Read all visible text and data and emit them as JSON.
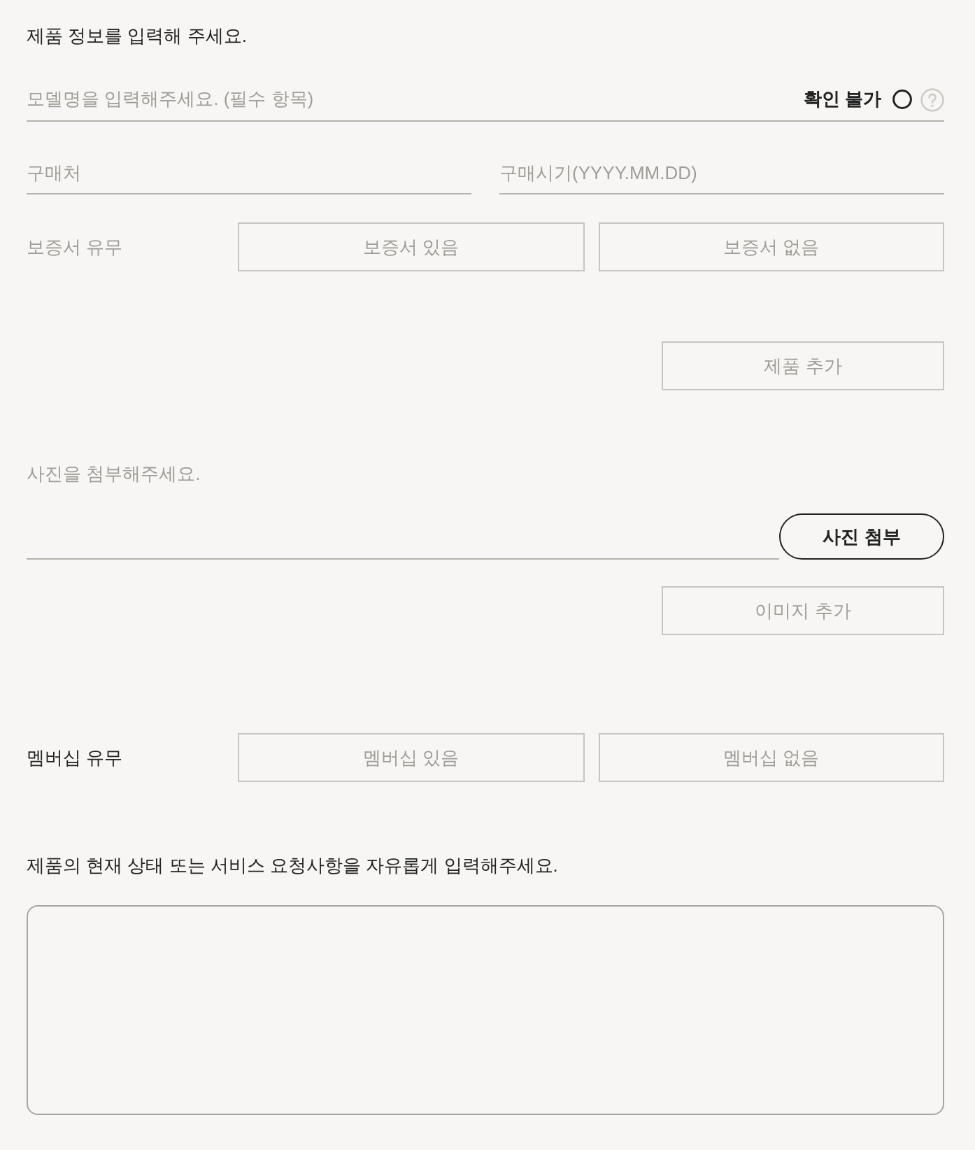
{
  "heading": "제품 정보를 입력해 주세요.",
  "model_field": {
    "placeholder": "모델명을 입력해주세요. (필수 항목)",
    "unknown_option": {
      "label": "확인 불가",
      "checked": false
    }
  },
  "purchase_fields": [
    {
      "placeholder": "구매처"
    },
    {
      "placeholder": "구매시기(YYYY.MM.DD)"
    }
  ],
  "warranty": {
    "label": "보증서 유무",
    "active": false,
    "options": [
      {
        "label": "보증서 있음",
        "selected": false
      },
      {
        "label": "보증서 없음",
        "selected": false
      }
    ]
  },
  "add_product_button": "제품 추가",
  "photo": {
    "label": "사진을 첨부해주세요.",
    "attach_button": "사진 첨부",
    "add_image_button": "이미지 추가"
  },
  "membership": {
    "label": "멤버십 유무",
    "active": true,
    "options": [
      {
        "label": "멤버십 있음",
        "selected": false
      },
      {
        "label": "멤버십 없음",
        "selected": false
      }
    ]
  },
  "request": {
    "label": "제품의 현재 상태 또는 서비스 요청사항을 자유롭게 입력해주세요."
  }
}
